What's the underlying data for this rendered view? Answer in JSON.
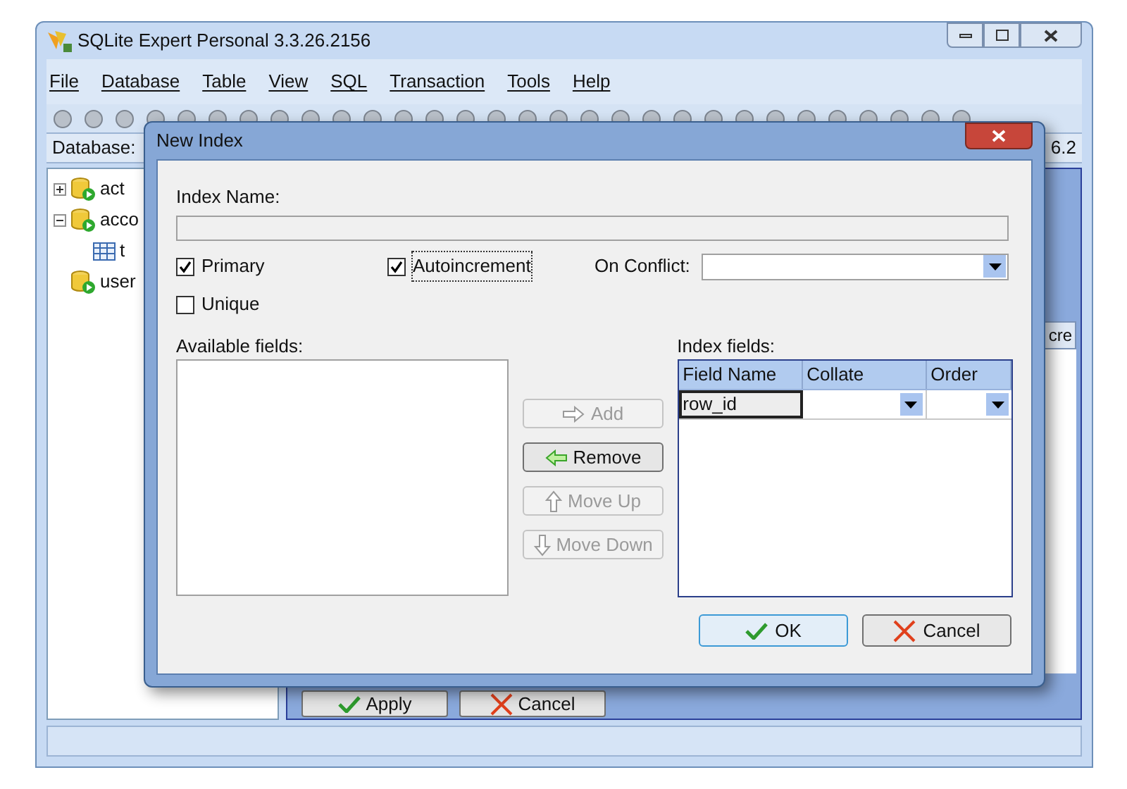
{
  "window": {
    "title": "SQLite Expert Personal 3.3.26.2156"
  },
  "menu": [
    "File",
    "Database",
    "Table",
    "View",
    "SQL",
    "Transaction",
    "Tools",
    "Help"
  ],
  "database_bar": {
    "label": "Database:",
    "version": "6.2"
  },
  "tree": [
    {
      "label": "act",
      "expanded": false
    },
    {
      "label": "acco",
      "expanded": true,
      "children": [
        {
          "label": "t"
        }
      ]
    },
    {
      "label": "user"
    }
  ],
  "grid_header": {
    "column_3": "cre"
  },
  "main_buttons": [
    {
      "label": "Apply",
      "kind": "apply"
    },
    {
      "label": "Cancel",
      "kind": "cancel"
    }
  ],
  "dialog": {
    "title": "New Index",
    "index_name": {
      "label": "Index Name:"
    },
    "options": [
      {
        "label": "Primary",
        "checked": true,
        "focused": false
      },
      {
        "label": "Autoincrement",
        "checked": true,
        "focused": true
      },
      {
        "label": "Unique",
        "checked": false,
        "focused": false
      }
    ],
    "on_conflict": {
      "label": "On Conflict:"
    },
    "available_fields": {
      "label": "Available fields:"
    },
    "move_buttons": [
      {
        "label": "Add",
        "kind": "right",
        "disabled": true
      },
      {
        "label": "Remove",
        "kind": "left",
        "disabled": false
      },
      {
        "label": "Move Up",
        "kind": "up",
        "disabled": true
      },
      {
        "label": "Move Down",
        "kind": "down",
        "disabled": true
      }
    ],
    "index_fields": {
      "label": "Index fields:",
      "columns": [
        "Field Name",
        "Collate",
        "Order"
      ],
      "rows": [
        {
          "field_name": "row_id",
          "collate": "",
          "order": ""
        }
      ]
    },
    "buttons": [
      {
        "label": "OK",
        "kind": "ok"
      },
      {
        "label": "Cancel",
        "kind": "cancel"
      }
    ]
  }
}
